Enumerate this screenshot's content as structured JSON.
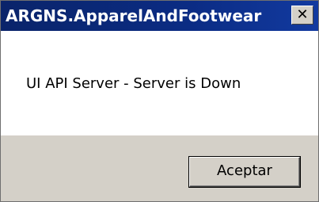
{
  "dialog": {
    "title": "ARGNS.ApparelAndFootwear",
    "close_glyph": "✕",
    "message": "UI API Server - Server is Down",
    "ok_label": "Aceptar"
  },
  "colors": {
    "titlebar": "#0a246a",
    "title_text": "#ffffff",
    "content_bg": "#ffffff",
    "footer_bg": "#d4d0c8",
    "button_face": "#d4d0c8"
  },
  "icons": {
    "close": "close-icon"
  }
}
